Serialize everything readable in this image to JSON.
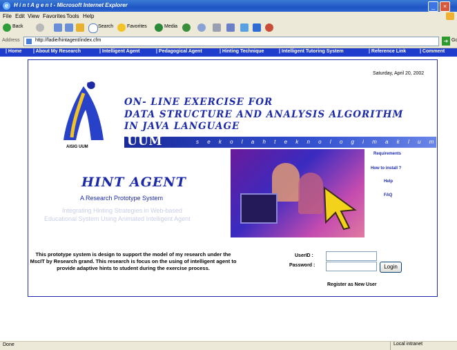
{
  "window": {
    "title": "H i n t  A g e n t - Microsoft Internet Explorer"
  },
  "menu": [
    "File",
    "Edit",
    "View",
    "Favorites",
    "Tools",
    "Help"
  ],
  "toolbar": {
    "back": "Back",
    "search": "Search",
    "favorites": "Favorites",
    "media": "Media"
  },
  "address": {
    "label": "Address",
    "url": "http://fadie/hintagent/index.cfm",
    "go": "Go"
  },
  "nav": [
    "| Home",
    "| About My Research",
    "| Intelligent Agent",
    "| Pedagogical Agent",
    "| Hinting Technique",
    "| Intelligent Tutoring System",
    "| Reference Link",
    "| Comment"
  ],
  "page": {
    "date": "Saturday, April 20, 2002",
    "logo_caption": "AISIG UUM",
    "header_lines": [
      "ON- LINE EXERCISE FOR",
      "DATA STRUCTURE AND ANALYSIS ALGORITHM",
      "IN JAVA LANGUAGE"
    ],
    "uum": "UUM",
    "faculty": "s e k o l a h   t e k n o l o g i   m a k l u m a t",
    "links": [
      "Requirements",
      "How to install ?",
      "Help",
      "FAQ"
    ],
    "hint_title": "HINT AGENT",
    "hint_subtitle": "A Research Prototype System",
    "tagline1": "Integrating Hinting Strategies in Web-based",
    "tagline2": "Educational System Using Animated Intelligent Agent",
    "description": "This prototype system is design to support the model of my research under the MscIT by Research grand. This research is focus on the using of intelligent agent to provide adaptive hints to student during the exercise process.",
    "login": {
      "userid_label": "UserID  :",
      "password_label": "Password  :",
      "button": "Login",
      "register": "Register as New User"
    }
  },
  "status": {
    "left": "Done",
    "zone": "Local intranet"
  },
  "colors": {
    "title_blue": "#1c2aa8",
    "nav_blue": "#1e3dcc",
    "frame_border": "#1c28b0"
  }
}
